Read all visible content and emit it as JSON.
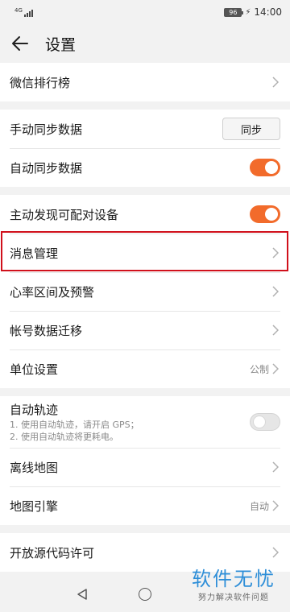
{
  "status": {
    "network": "4G",
    "battery": "96",
    "time": "14:00"
  },
  "header": {
    "title": "设置"
  },
  "sections": [
    {
      "rows": [
        {
          "label": "微信排行榜"
        }
      ]
    },
    {
      "rows": [
        {
          "label": "手动同步数据",
          "button": "同步"
        },
        {
          "label": "自动同步数据",
          "toggle": "on"
        }
      ]
    },
    {
      "rows": [
        {
          "label": "主动发现可配对设备",
          "toggle": "on"
        },
        {
          "label": "消息管理"
        },
        {
          "label": "心率区间及预警"
        },
        {
          "label": "帐号数据迁移"
        },
        {
          "label": "单位设置",
          "value": "公制"
        }
      ]
    },
    {
      "rows": [
        {
          "label": "自动轨迹",
          "sub1": "1. 使用自动轨迹，请开启 GPS；",
          "sub2": "2. 使用自动轨迹将更耗电。",
          "toggle": "off"
        },
        {
          "label": "离线地图"
        },
        {
          "label": "地图引擎",
          "value": "自动"
        }
      ]
    },
    {
      "rows": [
        {
          "label": "开放源代码许可"
        }
      ]
    }
  ],
  "watermark": {
    "main": "软件无忧",
    "sub": "努力解决软件问题"
  },
  "colors": {
    "accent": "#f26b2b",
    "highlight": "#d0101b",
    "watermark": "#2d8ed8"
  },
  "icons": {
    "back": "arrow-left-icon",
    "chevron": "chevron-right-icon",
    "nav_back": "triangle-back-icon",
    "nav_home": "circle-home-icon"
  }
}
